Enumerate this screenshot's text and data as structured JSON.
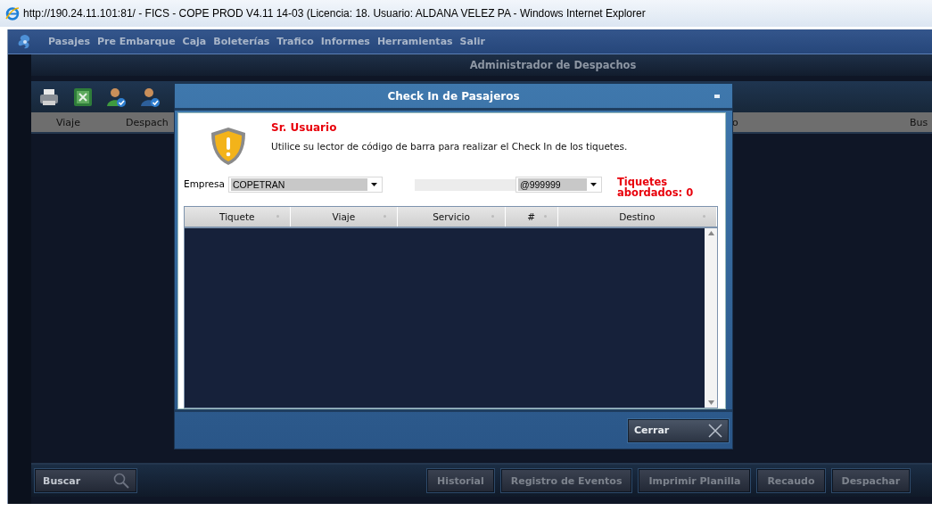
{
  "window": {
    "title": "http://190.24.11.101:81/ - FICS - COPE PROD V4.11 14-03 (Licencia: 18. Usuario: ALDANA VELEZ PA - Windows Internet Explorer"
  },
  "menu": [
    "Pasajes",
    "Pre Embarque",
    "Caja",
    "Boleterías",
    "Trafico",
    "Informes",
    "Herramientas",
    "Salir"
  ],
  "panel_title": "Administrador de Despachos",
  "background_table": {
    "columns": [
      "Viaje",
      "Despach",
      "o",
      "Bus"
    ]
  },
  "dialog": {
    "title": "Check In de Pasajeros",
    "heading": "Sr. Usuario",
    "message": "Utilice su lector de código de barra para realizar el Check In de los tiquetes.",
    "empresa_label": "Empresa",
    "empresa_value": "COPETRAN",
    "code_value": "@999999",
    "counter": "Tiquetes abordados: 0",
    "columns": [
      "Tiquete",
      "Viaje",
      "Servicio",
      "#",
      "Destino"
    ],
    "close_button": "Cerrar"
  },
  "search_button": "Buscar",
  "bottom_buttons": [
    {
      "label": "Historial",
      "disabled": true
    },
    {
      "label": "Registro de Eventos",
      "disabled": true
    },
    {
      "label": "Imprimir Planilla",
      "disabled": true
    },
    {
      "label": "Recaudo",
      "disabled": true
    },
    {
      "label": "Despachar",
      "disabled": true
    }
  ]
}
